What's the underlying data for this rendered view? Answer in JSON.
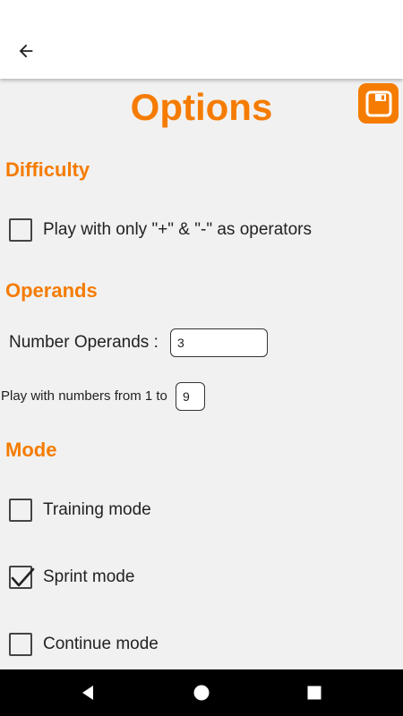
{
  "header": {
    "back_icon": "arrow-left-icon",
    "title": "Options",
    "save_icon": "floppy-disk-icon",
    "accent_color": "#f57c00"
  },
  "difficulty": {
    "section_title": "Difficulty",
    "only_plus_minus": {
      "label": "Play with only \"+\" & \"-\" as operators",
      "checked": false
    }
  },
  "operands": {
    "section_title": "Operands",
    "number_operands_label": "Number Operands :",
    "number_operands_value": "3",
    "range_label": "Play with numbers from 1 to",
    "range_value": "9"
  },
  "mode": {
    "section_title": "Mode",
    "training": {
      "label": "Training mode",
      "checked": false
    },
    "sprint": {
      "label": "Sprint mode",
      "checked": true
    },
    "continue": {
      "label": "Continue mode",
      "checked": false
    }
  },
  "navbar": {
    "back_icon": "triangle-back-icon",
    "home_icon": "circle-home-icon",
    "recents_icon": "square-recents-icon"
  }
}
